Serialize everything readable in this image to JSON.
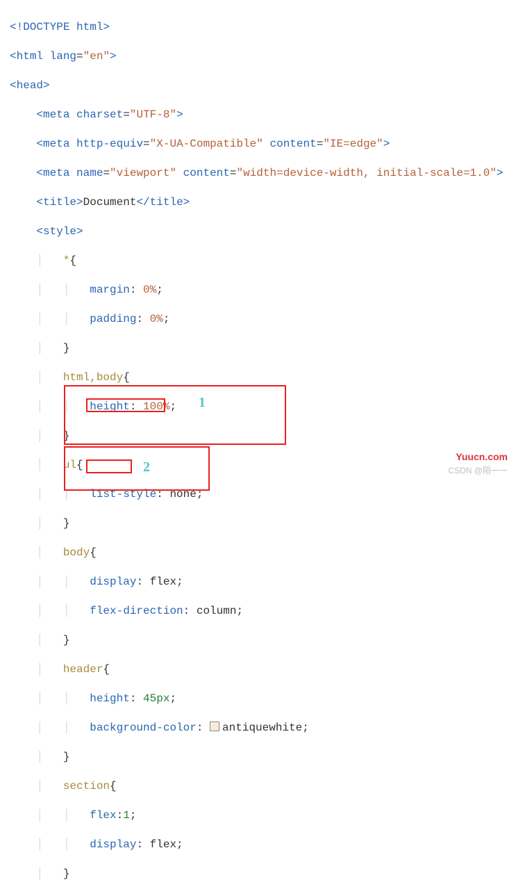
{
  "code": {
    "l1_open": "<",
    "l1_doctype": "!DOCTYPE",
    "l1_html": "html",
    "l1_close": ">",
    "l2": "<html lang=\"en\">",
    "html_tag": "html",
    "lang_attr": "lang",
    "lang_val": "\"en\"",
    "head_tag": "head",
    "meta_tag": "meta",
    "charset_attr": "charset",
    "charset_val": "\"UTF-8\"",
    "httpequiv_attr": "http-equiv",
    "httpequiv_val": "\"X-UA-Compatible\"",
    "content_attr": "content",
    "edge_val": "\"IE=edge\"",
    "name_attr": "name",
    "viewport_val": "\"viewport\"",
    "content_viewport": "\"width=device-width, initial-scale=1.0\"",
    "title_tag": "title",
    "title_text": "Document",
    "style_tag": "style",
    "sel_star": "*",
    "margin": "margin",
    "zero_pct": "0%",
    "padding": "padding",
    "sel_htmlbody": "html,body",
    "height": "height",
    "hundred_pct": "100%",
    "sel_ul": "ul",
    "liststyle": "list-style",
    "none": "none",
    "sel_body": "body",
    "display": "display",
    "flex": "flex",
    "flexdir": "flex-direction",
    "column": "column",
    "sel_header": "header",
    "fortyfive": "45px",
    "bgcolor": "background-color",
    "antique_swatch": "antiquewhite",
    "sel_section": "section",
    "flex_prop": "flex",
    "one": "1"
  },
  "annotations": {
    "a1": "1",
    "a2": "2"
  },
  "watermark": {
    "w1": "Yuucn.com",
    "w2": "CSDN @陌一一"
  }
}
